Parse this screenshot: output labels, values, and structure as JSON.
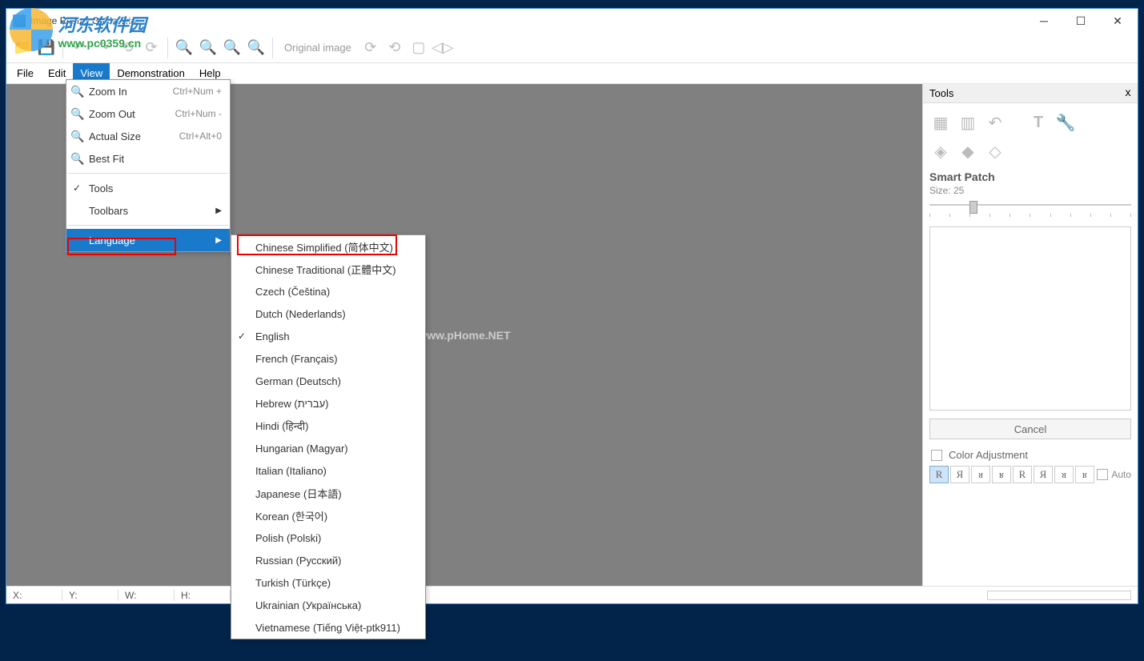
{
  "window": {
    "title": "Image Resize Guide Trial"
  },
  "toolbar": {
    "original_image": "Original image"
  },
  "menubar": {
    "file": "File",
    "edit": "Edit",
    "view": "View",
    "demonstration": "Demonstration",
    "help": "Help"
  },
  "view_menu": {
    "zoom_in": "Zoom In",
    "zoom_in_sc": "Ctrl+Num +",
    "zoom_out": "Zoom Out",
    "zoom_out_sc": "Ctrl+Num -",
    "actual_size": "Actual Size",
    "actual_size_sc": "Ctrl+Alt+0",
    "best_fit": "Best Fit",
    "tools": "Tools",
    "toolbars": "Toolbars",
    "language": "Language"
  },
  "languages": {
    "zh_cn": "Chinese Simplified (简体中文)",
    "zh_tw": "Chinese Traditional (正體中文)",
    "cs": "Czech (Čeština)",
    "nl": "Dutch (Nederlands)",
    "en": "English",
    "fr": "French (Français)",
    "de": "German (Deutsch)",
    "he": "Hebrew (עברית)",
    "hi": "Hindi (हिन्दी)",
    "hu": "Hungarian (Magyar)",
    "it": "Italian (Italiano)",
    "ja": "Japanese (日本語)",
    "ko": "Korean (한국어)",
    "pl": "Polish (Polski)",
    "ru": "Russian (Русский)",
    "tr": "Turkish (Türkçe)",
    "uk": "Ukrainian (Українська)",
    "vi": "Vietnamese (Tiếng Việt-ptk911)"
  },
  "tools_panel": {
    "header": "Tools",
    "section": "Smart Patch",
    "size_label": "Size: 25",
    "cancel": "Cancel",
    "color_adjustment": "Color Adjustment",
    "auto": "Auto"
  },
  "statusbar": {
    "x": "X:",
    "y": "Y:",
    "w": "W:",
    "h": "H:"
  },
  "watermarks": {
    "canvas": "www.pHome.NET",
    "brand_cn": "河东软件园",
    "brand_url": "www.pc0359.cn"
  }
}
